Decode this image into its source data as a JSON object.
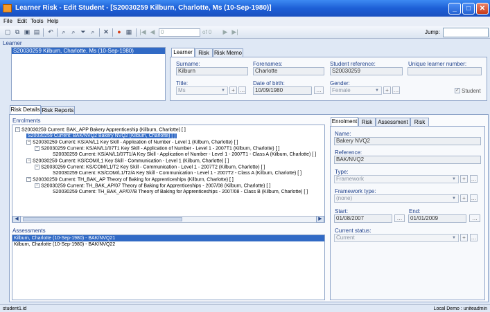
{
  "window": {
    "title": "Learner Risk - Edit Student - [S20030259 Kilburn, Charlotte, Ms (10-Sep-1980)]"
  },
  "menu": [
    "File",
    "Edit",
    "Tools",
    "Help"
  ],
  "toolbar": {
    "record_field": "0",
    "record_total": "of 0",
    "jump_label": "Jump:"
  },
  "learner": {
    "header": "Learner",
    "list": [
      "S20030259 Kilburn, Charlotte, Ms (10-Sep-1980)"
    ],
    "tabs": [
      "Learner",
      "Risk",
      "Risk Memo"
    ],
    "labels": {
      "surname": "Surname:",
      "forenames": "Forenames:",
      "student_ref": "Student reference:",
      "uln": "Unique learner number:",
      "title": "Title:",
      "dob": "Date of birth:",
      "gender": "Gender:",
      "student": "Student"
    },
    "values": {
      "surname": "Kilburn",
      "forenames": "Charlotte",
      "student_ref": "S20030259",
      "uln": "",
      "title": "Ms",
      "dob": "10/09/1980",
      "gender": "Female"
    }
  },
  "main_tabs": [
    "Risk Details",
    "Risk Reports"
  ],
  "enrolments": {
    "header": "Enrolments",
    "tree": [
      {
        "text": "S20030259 Current: BAK_APP Bakery Apprenticeship (Kilburn, Charlotte) [ ]",
        "toggle": "−"
      },
      {
        "text": "S20030259 Current: BAK/NVQ2 Bakery NVQ2 (Kilburn, Charlotte) [ ]",
        "toggle": ""
      },
      {
        "text": "S20030259 Current: KS/AN/L1 Key Skill - Application of Number - Level 1 (Kilburn, Charlotte) [ ]",
        "toggle": "−"
      },
      {
        "text": "S20030259 Current: KS/AN/L1/07T1 Key Skill - Application of Number - Level 1 - 2007T1 (Kilburn, Charlotte) [ ]",
        "toggle": "−"
      },
      {
        "text": "S20030259 Current: KS/AN/L1/07T1/A Key Skill - Application of Number - Level 1 - 2007T1 - Class A (Kilburn, Charlotte) [ ]",
        "toggle": ""
      },
      {
        "text": "S20030259 Current: KS/COM/L1 Key Skill - Communication - Level 1 (Kilburn, Charlotte) [ ]",
        "toggle": "−"
      },
      {
        "text": "S20030259 Current: KS/COM/L1/T2 Key Skill - Communication - Level 1 - 2007T2 (Kilburn, Charlotte) [ ]",
        "toggle": "−"
      },
      {
        "text": "S20030259 Current: KS/COM/L1/T2/A Key Skill - Communication - Level 1 - 2007T2 - Class A (Kilburn, Charlotte) [ ]",
        "toggle": ""
      },
      {
        "text": "S20030259 Current: TH_BAK_AP Theory of Baking for Apprenticeships (Kilburn, Charlotte) [ ]",
        "toggle": "−"
      },
      {
        "text": "S20030259 Current: TH_BAK_AP/07 Theory of Baking for Apprenticeships - 2007/08 (Kilburn, Charlotte) [ ]",
        "toggle": "−"
      },
      {
        "text": "S20030259 Current: TH_BAK_AP/07/B Theory of Baking for Apprenticeships - 2007/08 - Class B (Kilburn, Charlotte) [ ]",
        "toggle": ""
      }
    ]
  },
  "assessments": {
    "header": "Assessments",
    "items": [
      "Kilburn, Charlotte (10-Sep-1980) - BAK/NVQ21",
      "Kilburn, Charlotte (10-Sep-1980) - BAK/NVQ22"
    ]
  },
  "detail": {
    "tabs": [
      "Enrolment",
      "Risk",
      "Assessment",
      "Risk"
    ],
    "labels": {
      "name": "Name:",
      "reference": "Reference:",
      "type": "Type:",
      "framework_type": "Framework type:",
      "start": "Start:",
      "end": "End:",
      "status": "Current status:"
    },
    "values": {
      "name": "Bakery NVQ2",
      "reference": "BAK/NVQ2",
      "type": "Framework",
      "framework_type": "(none)",
      "start": "01/08/2007",
      "end": "01/01/2009",
      "status": "Current"
    }
  },
  "statusbar": {
    "left": "student1.id",
    "right": "Local Demo : uniteadmin"
  },
  "colors": {
    "selection": "#316ac5",
    "titlebar": "#1d5fd6",
    "label": "#1d3f8a"
  }
}
